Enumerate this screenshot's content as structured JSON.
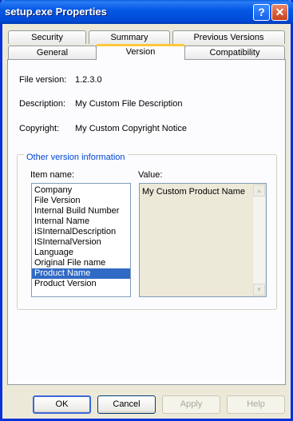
{
  "window": {
    "title": "setup.exe Properties",
    "help_glyph": "?",
    "close_glyph": "✕"
  },
  "tabs_back": [
    "Security",
    "Summary",
    "Previous Versions"
  ],
  "tabs_front": [
    "General",
    "Version",
    "Compatibility"
  ],
  "active_tab": "Version",
  "fields": [
    {
      "label": "File version:",
      "value": "1.2.3.0"
    },
    {
      "label": "Description:",
      "value": "My Custom File Description"
    },
    {
      "label": "Copyright:",
      "value": "My Custom Copyright Notice"
    }
  ],
  "group": {
    "title": "Other version information",
    "item_label": "Item name:",
    "value_label": "Value:",
    "items": [
      "Company",
      "File Version",
      "Internal Build Number",
      "Internal Name",
      "ISInternalDescription",
      "ISInternalVersion",
      "Language",
      "Original File name",
      "Product Name",
      "Product Version"
    ],
    "selected_item": "Product Name",
    "value": "My Custom Product Name"
  },
  "buttons": {
    "ok": "OK",
    "cancel": "Cancel",
    "apply": "Apply",
    "help": "Help"
  },
  "icons": {
    "scroll_up": "▲",
    "scroll_down": "▼"
  },
  "colors": {
    "titlebar": "#0559e6",
    "selection": "#316ac5",
    "active_tab_accent": "#ffc83c",
    "group_title": "#0046d5"
  }
}
